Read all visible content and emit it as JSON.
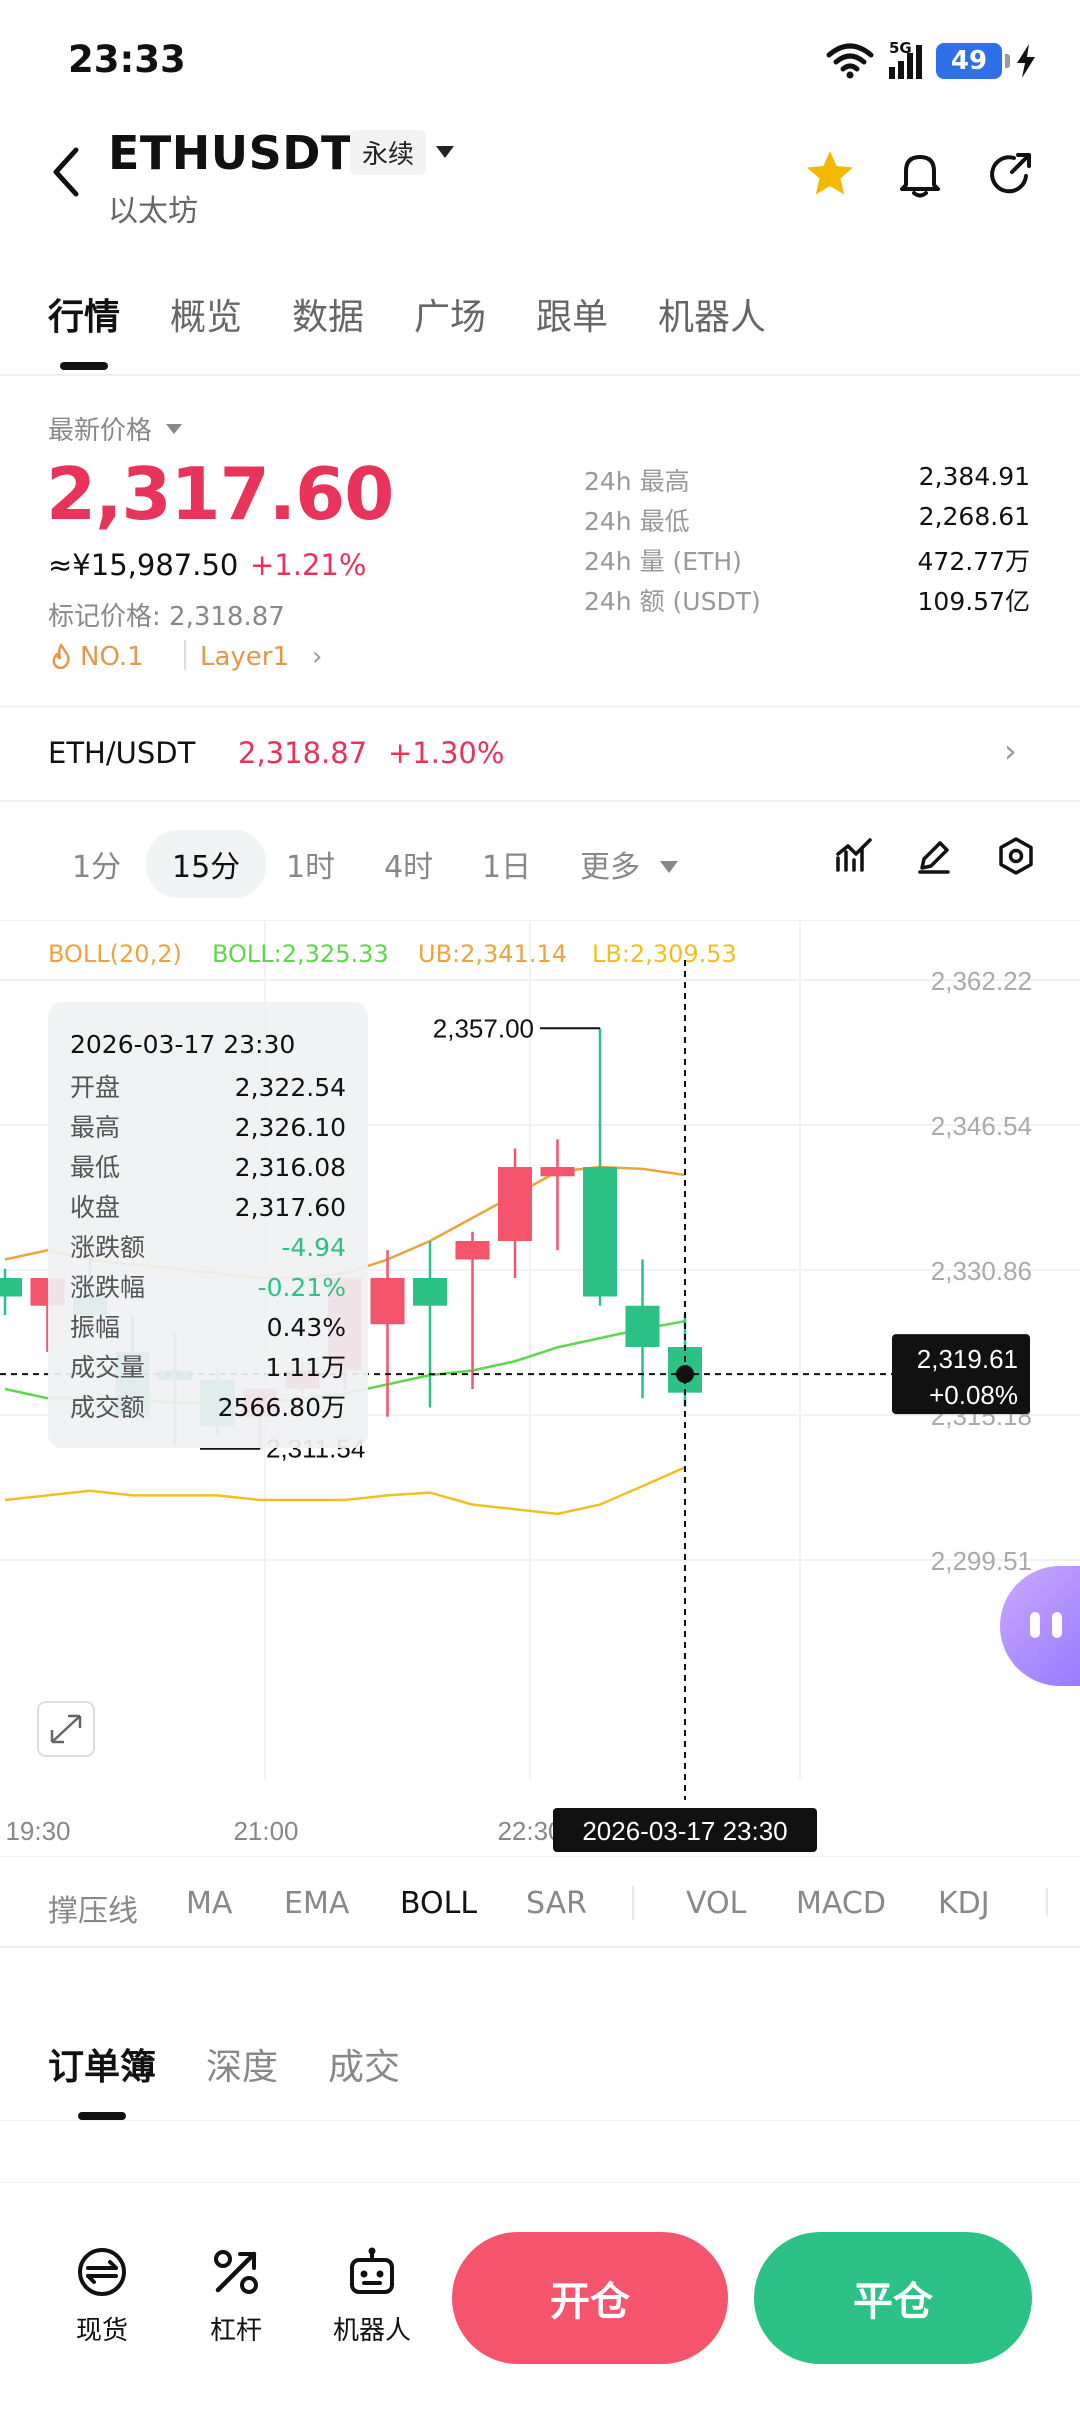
{
  "status": {
    "time": "23:33",
    "network": "5G",
    "battery": "49"
  },
  "header": {
    "pair": "ETHUSDT",
    "contract_type": "永续",
    "subtitle": "以太坊",
    "icons": [
      "star-icon",
      "bell-icon",
      "share-icon"
    ],
    "accent_star": "#f5b800"
  },
  "tabs": [
    "行情",
    "概览",
    "数据",
    "广场",
    "跟单",
    "机器人"
  ],
  "price": {
    "latest_label": "最新价格",
    "last": "2,317.60",
    "cny": "≈¥15,987.50",
    "change_pct": "+1.21%",
    "mark_label": "标记价格: 2,318.87",
    "tag_rank": "NO.1",
    "tag_sector": "Layer1",
    "color_up": "#e8335a",
    "color_down": "#2cc285"
  },
  "stats": [
    {
      "label": "24h  最高",
      "value": "2,384.91"
    },
    {
      "label": "24h  最低",
      "value": "2,268.61"
    },
    {
      "label": "24h  量 (ETH)",
      "value": "472.77万"
    },
    {
      "label": "24h  额 (USDT)",
      "value": "109.57亿"
    }
  ],
  "index": {
    "name": "ETH/USDT",
    "price": "2,318.87",
    "change": "+1.30%"
  },
  "intervals": [
    "1分",
    "15分",
    "1时",
    "4时",
    "1日",
    "更多"
  ],
  "active_interval": "15分",
  "boll_legend": {
    "params": "BOLL(20,2)",
    "mid": "BOLL:2,325.33",
    "ub": "UB:2,341.14",
    "lb": "LB:2,309.53"
  },
  "tooltip": {
    "time": "2026-03-17 23:30",
    "rows": [
      {
        "label": "开盘",
        "value": "2,322.54"
      },
      {
        "label": "最高",
        "value": "2,326.10"
      },
      {
        "label": "最低",
        "value": "2,316.08"
      },
      {
        "label": "收盘",
        "value": "2,317.60"
      },
      {
        "label": "涨跌额",
        "value": "-4.94"
      },
      {
        "label": "涨跌幅",
        "value": "-0.21%"
      },
      {
        "label": "振幅",
        "value": "0.43%"
      },
      {
        "label": "成交量",
        "value": "1.11万"
      },
      {
        "label": "成交额",
        "value": "2566.80万"
      }
    ]
  },
  "chart_data": {
    "type": "candlestick",
    "y_ticks": [
      "2,362.22",
      "2,346.54",
      "2,330.86",
      "2,315.18",
      "2,299.51"
    ],
    "ylim": [
      2299.51,
      2362.22
    ],
    "x_ticks": [
      "19:30",
      "21:00",
      "22:30"
    ],
    "crosshair_time": "2026-03-17 23:30",
    "crosshair_price": "2,319.61",
    "crosshair_change": "+0.08%",
    "max_label": "2,357.00",
    "min_label": "2,311.54",
    "candles": [
      {
        "o": 2330,
        "h": 2331,
        "l": 2326,
        "c": 2328
      },
      {
        "o": 2327,
        "h": 2330,
        "l": 2322,
        "c": 2330
      },
      {
        "o": 2328,
        "h": 2332,
        "l": 2325,
        "c": 2326
      },
      {
        "o": 2322,
        "h": 2326,
        "l": 2315,
        "c": 2315
      },
      {
        "o": 2320,
        "h": 2324,
        "l": 2312,
        "c": 2319
      },
      {
        "o": 2319,
        "h": 2320,
        "l": 2313,
        "c": 2314
      },
      {
        "o": 2315,
        "h": 2318,
        "l": 2311.54,
        "c": 2318
      },
      {
        "o": 2318,
        "h": 2321,
        "l": 2316,
        "c": 2320
      },
      {
        "o": 2320,
        "h": 2330,
        "l": 2318,
        "c": 2330
      },
      {
        "o": 2325,
        "h": 2333,
        "l": 2315,
        "c": 2330
      },
      {
        "o": 2330,
        "h": 2334,
        "l": 2316,
        "c": 2327
      },
      {
        "o": 2332,
        "h": 2335,
        "l": 2318,
        "c": 2334
      },
      {
        "o": 2334,
        "h": 2344,
        "l": 2330,
        "c": 2342
      },
      {
        "o": 2341,
        "h": 2345,
        "l": 2333,
        "c": 2342
      },
      {
        "o": 2342,
        "h": 2357,
        "l": 2327,
        "c": 2328
      },
      {
        "o": 2327,
        "h": 2332,
        "l": 2317,
        "c": 2322.54
      },
      {
        "o": 2322.54,
        "h": 2326.1,
        "l": 2316.08,
        "c": 2317.6
      }
    ],
    "boll_mid": [
      2318,
      2317,
      2317,
      2317,
      2316.5,
      2316.5,
      2316.5,
      2317,
      2317.5,
      2318.5,
      2319.5,
      2320,
      2321,
      2322.5,
      2323.5,
      2324.5,
      2325.33
    ],
    "boll_ub": [
      2332,
      2333,
      2332,
      2331.5,
      2331,
      2330.5,
      2330,
      2330,
      2330.5,
      2332,
      2334,
      2336.5,
      2339,
      2341.5,
      2342,
      2341.8,
      2341.14
    ],
    "boll_lb": [
      2306,
      2306.5,
      2307,
      2306.5,
      2306.5,
      2306.5,
      2306,
      2306,
      2306,
      2306.5,
      2306.8,
      2305.5,
      2305,
      2304.5,
      2305.5,
      2307.5,
      2309.53
    ],
    "colors": {
      "up": "#f4546c",
      "down": "#2cc285",
      "mid": "#5ed84b",
      "ub": "#f0a33c",
      "lb": "#f0c020"
    }
  },
  "indicators": [
    "撑压线",
    "MA",
    "EMA",
    "BOLL",
    "SAR",
    "VOL",
    "MACD",
    "KDJ"
  ],
  "active_indicator": "BOLL",
  "orderbook_tabs": [
    "订单簿",
    "深度",
    "成交"
  ],
  "bottom_bar": {
    "items": [
      {
        "label": "现货",
        "icon": "spot-icon"
      },
      {
        "label": "杠杆",
        "icon": "leverage-icon"
      },
      {
        "label": "机器人",
        "icon": "robot-icon"
      }
    ],
    "open_label": "开仓",
    "close_label": "平仓"
  }
}
